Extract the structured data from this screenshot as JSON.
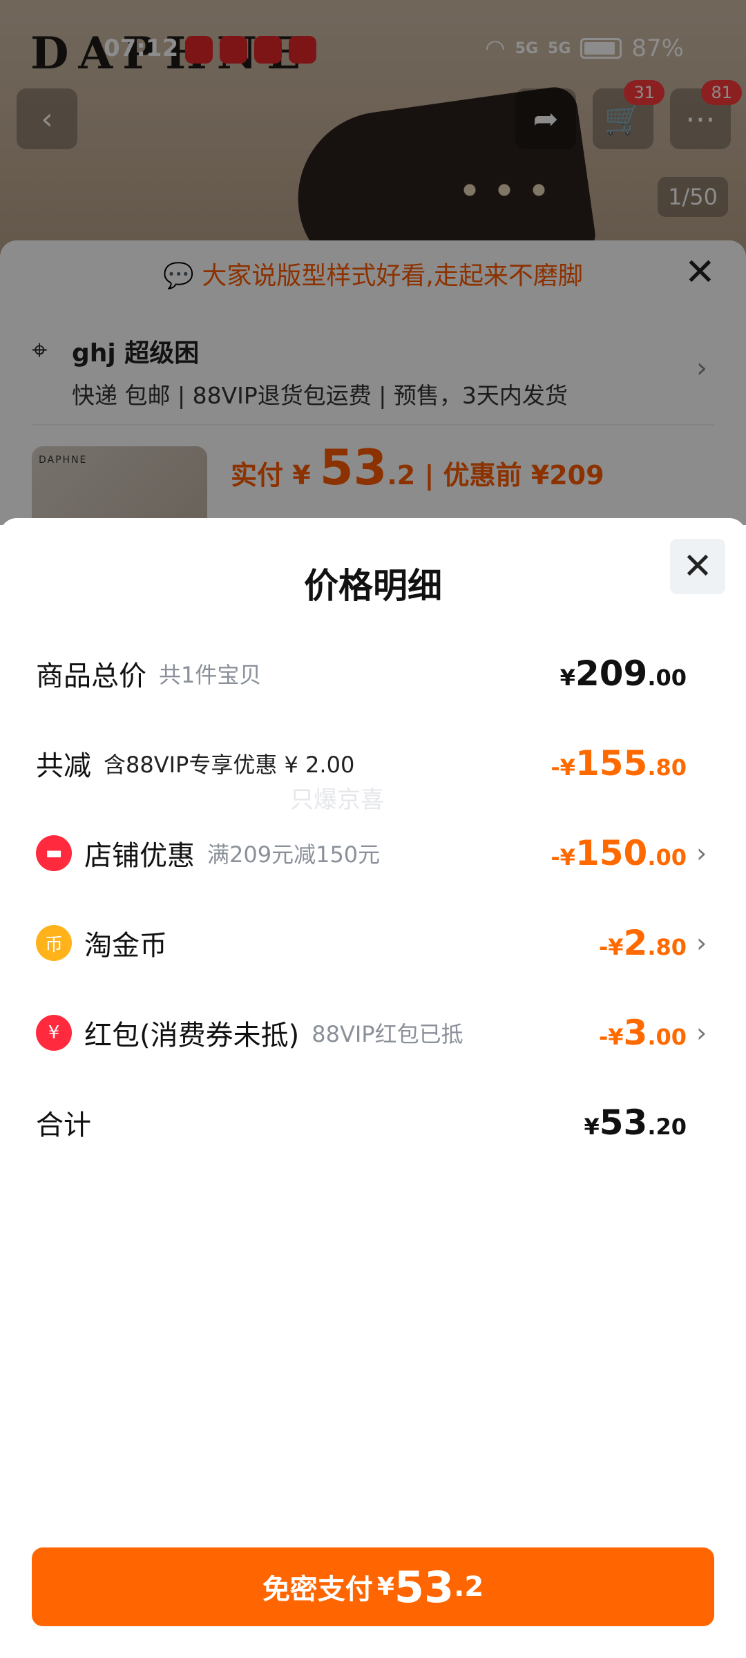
{
  "status_bar": {
    "time": "07:12",
    "battery": "87%",
    "signal_1": "5G",
    "signal_2": "5G"
  },
  "background_page": {
    "brand_logo": "DAPHNE",
    "cart_badge": "31",
    "msg_badge": "81",
    "image_counter": "1/50",
    "tip_text": "大家说版型样式好看,走起来不磨脚",
    "address_name": "ghj 超级困",
    "address_sub": "快递 包邮 | 88VIP退货包运费 | 预售，3天内发货",
    "price_prefix": "实付 ¥",
    "price_int": "53",
    "price_dec": ".2",
    "price_before": "| 优惠前 ¥209",
    "thumb_brand": "DAPHNE"
  },
  "sheet": {
    "title": "价格明细",
    "watermark": "只爆京喜",
    "rows": [
      {
        "label": "商品总价",
        "sub": "共1件宝贝",
        "sign": "",
        "cur": "¥",
        "int": "209",
        "dec": ".00"
      },
      {
        "label": "共减",
        "sub": "含88VIP专享优惠 ¥ 2.00",
        "sign": "-",
        "cur": "¥",
        "int": "155",
        "dec": ".80"
      },
      {
        "label": "店铺优惠",
        "sub": "满209元减150元",
        "sign": "-",
        "cur": "¥",
        "int": "150",
        "dec": ".00",
        "icon": "store-icon"
      },
      {
        "label": "淘金币",
        "sub": "",
        "sign": "-",
        "cur": "¥",
        "int": "2",
        "dec": ".80",
        "icon": "gold-coin-icon"
      },
      {
        "label": "红包(消费券未抵)",
        "sub": "88VIP红包已抵",
        "sign": "-",
        "cur": "¥",
        "int": "3",
        "dec": ".00",
        "icon": "red-packet-icon"
      },
      {
        "label": "合计",
        "sub": "",
        "sign": "",
        "cur": "¥",
        "int": "53",
        "dec": ".20"
      }
    ]
  },
  "pay_button": {
    "label": "免密支付",
    "cur": "¥",
    "int": "53",
    "dec": ".2"
  },
  "colors": {
    "accent": "#ff6500",
    "discount": "#ff6a00",
    "text": "#111111",
    "muted": "#8a9099"
  }
}
